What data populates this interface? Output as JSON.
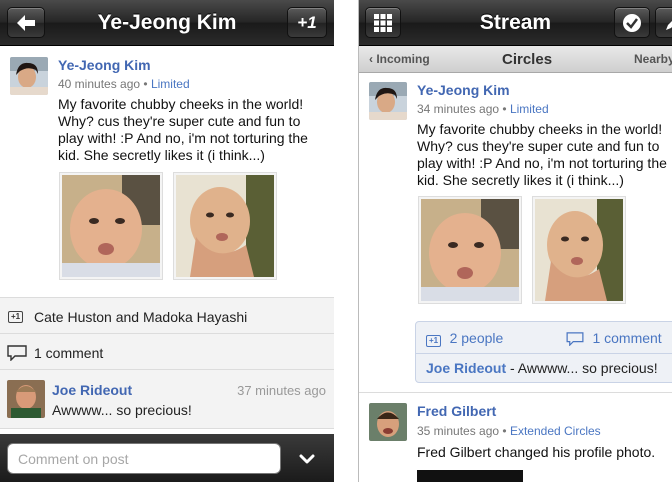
{
  "left": {
    "title": "Ye-Jeong Kim",
    "plus_one_label": "+1",
    "post": {
      "author": "Ye-Jeong Kim",
      "time": "40 minutes ago",
      "separator": "•",
      "visibility": "Limited",
      "text": "My favorite chubby cheeks in the world! Why? cus they're super cute and fun to play with! :P And no, i'm not torturing the kid. She secretly likes it (i think...)"
    },
    "plus_ones": {
      "badge": "+1",
      "text": "Cate Huston and Madoka Hayashi"
    },
    "comments_count": "1 comment",
    "comment": {
      "author": "Joe Rideout",
      "time": "37 minutes ago",
      "text": "Awwww... so precious!"
    },
    "comment_input": {
      "placeholder": "Comment on post"
    }
  },
  "right": {
    "title": "Stream",
    "subnav": {
      "left": "Incoming",
      "center": "Circles",
      "right": "Nearby"
    },
    "post": {
      "author": "Ye-Jeong Kim",
      "time": "34 minutes ago",
      "separator": "•",
      "visibility": "Limited",
      "text": "My favorite chubby cheeks in the world! Why? cus they're super cute and fun to play with! :P And no, i'm not torturing the kid. She secretly likes it (i think...)"
    },
    "stats": {
      "plus_badge": "+1",
      "people": "2 people",
      "comments": "1 comment",
      "last_comment_author": "Joe Rideout",
      "last_comment_text": " - Awwww... so precious!"
    },
    "post2": {
      "author": "Fred Gilbert",
      "time": "35 minutes ago",
      "separator": "•",
      "visibility": "Extended Circles",
      "text": "Fred Gilbert changed his profile photo."
    }
  },
  "icons": {
    "back": "back-arrow-icon",
    "grid": "grid-icon",
    "check": "checkmark-icon",
    "pencil": "pencil-icon",
    "comment": "speech-bubble-icon",
    "chevron": "chevron-down-icon"
  }
}
